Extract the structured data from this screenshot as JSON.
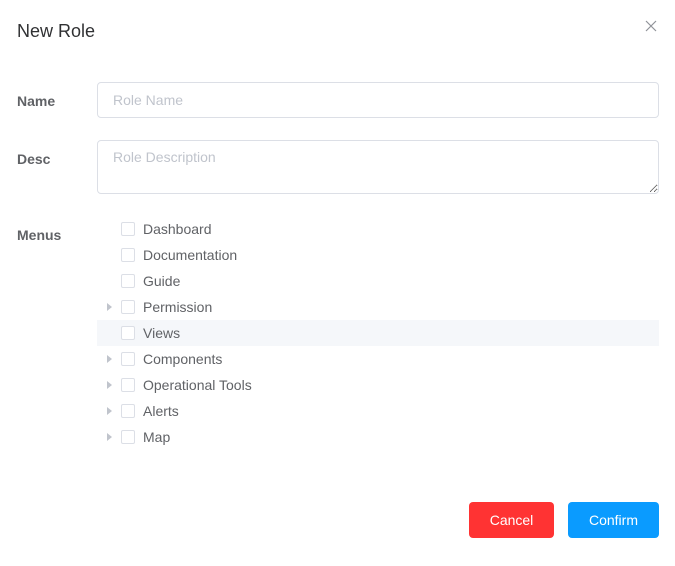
{
  "dialog": {
    "title": "New Role"
  },
  "form": {
    "name_label": "Name",
    "name_placeholder": "Role Name",
    "name_value": "",
    "desc_label": "Desc",
    "desc_placeholder": "Role Description",
    "desc_value": "",
    "menus_label": "Menus"
  },
  "menus": {
    "items": [
      {
        "label": "Dashboard",
        "expandable": false,
        "checked": false
      },
      {
        "label": "Documentation",
        "expandable": false,
        "checked": false
      },
      {
        "label": "Guide",
        "expandable": false,
        "checked": false
      },
      {
        "label": "Permission",
        "expandable": true,
        "checked": false
      },
      {
        "label": "Views",
        "expandable": false,
        "checked": false,
        "highlighted": true
      },
      {
        "label": "Components",
        "expandable": true,
        "checked": false
      },
      {
        "label": "Operational Tools",
        "expandable": true,
        "checked": false
      },
      {
        "label": "Alerts",
        "expandable": true,
        "checked": false
      },
      {
        "label": "Map",
        "expandable": true,
        "checked": false
      }
    ]
  },
  "footer": {
    "cancel_label": "Cancel",
    "confirm_label": "Confirm"
  },
  "colors": {
    "cancel": "#ff3333",
    "confirm": "#0a9bff"
  },
  "icons": {
    "close": "close-icon",
    "expand": "caret-right-icon"
  }
}
